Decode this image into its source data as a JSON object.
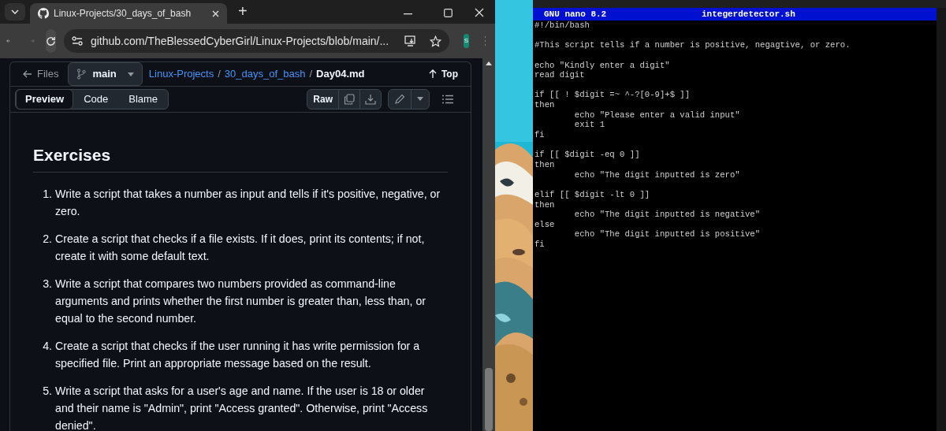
{
  "browser": {
    "tabs": [
      {
        "title": "Linux-Projects/30_days_of_bash",
        "selected": true
      }
    ],
    "new_tab": "+",
    "address": "github.com/TheBlessedCyberGirl/Linux-Projects/blob/main/...",
    "profile_initial": "S",
    "file_header": {
      "files_label": "Files",
      "separator": "/",
      "branch": "main",
      "breadcrumb": [
        {
          "label": "Linux-Projects",
          "kind": "link"
        },
        {
          "label": "30_days_of_bash",
          "kind": "link"
        },
        {
          "label": "Day04.md",
          "kind": "current"
        }
      ],
      "top_label": "Top"
    },
    "view_tabs": [
      {
        "label": "Preview",
        "selected": true
      },
      {
        "label": "Code",
        "selected": false
      },
      {
        "label": "Blame",
        "selected": false
      }
    ],
    "raw_label": "Raw",
    "document": {
      "heading": "Exercises",
      "items": [
        {
          "number": "1.",
          "text": "Write a script that takes a number as input and tells if it's positive, negative, or zero."
        },
        {
          "number": "2.",
          "text": "Create a script that checks if a file exists. If it does, print its contents; if not, create it with some default text."
        },
        {
          "number": "3.",
          "text": "Write a script that compares two numbers provided as command-line arguments and prints whether the first number is greater than, less than, or equal to the second number."
        },
        {
          "number": "4.",
          "text": "Create a script that checks if the user running it has write permission for a specified file. Print an appropriate message based on the result."
        },
        {
          "number": "5.",
          "text": "Write a script that asks for a user's age and name. If the user is 18 or older and their name is \"Admin\", print \"Access granted\". Otherwise, print \"Access denied\"."
        }
      ]
    }
  },
  "terminal": {
    "editor": "GNU nano 8.2",
    "filename": "integerdetector.sh",
    "blocks": [
      [
        "#!/bin/bash"
      ],
      [
        "#This script tells if a number is positive, negagtive, or zero."
      ],
      [
        "echo \"Kindly enter a digit\"",
        "read digit"
      ],
      [
        "if [[ ! $digit =~ ^-?[0-9]+$ ]]",
        "then",
        "\techo \"Please enter a valid input\"",
        "\texit 1",
        "fi"
      ],
      [
        "if [[ $digit -eq 0 ]]",
        "then",
        "\techo \"The digit inputted is zero\""
      ],
      [
        "elif [[ $digit -lt 0 ]]",
        "then",
        "\techo \"The digit inputted is negative\"",
        "else",
        "\techo \"The digit inputted is positive\"",
        "fi"
      ]
    ]
  }
}
